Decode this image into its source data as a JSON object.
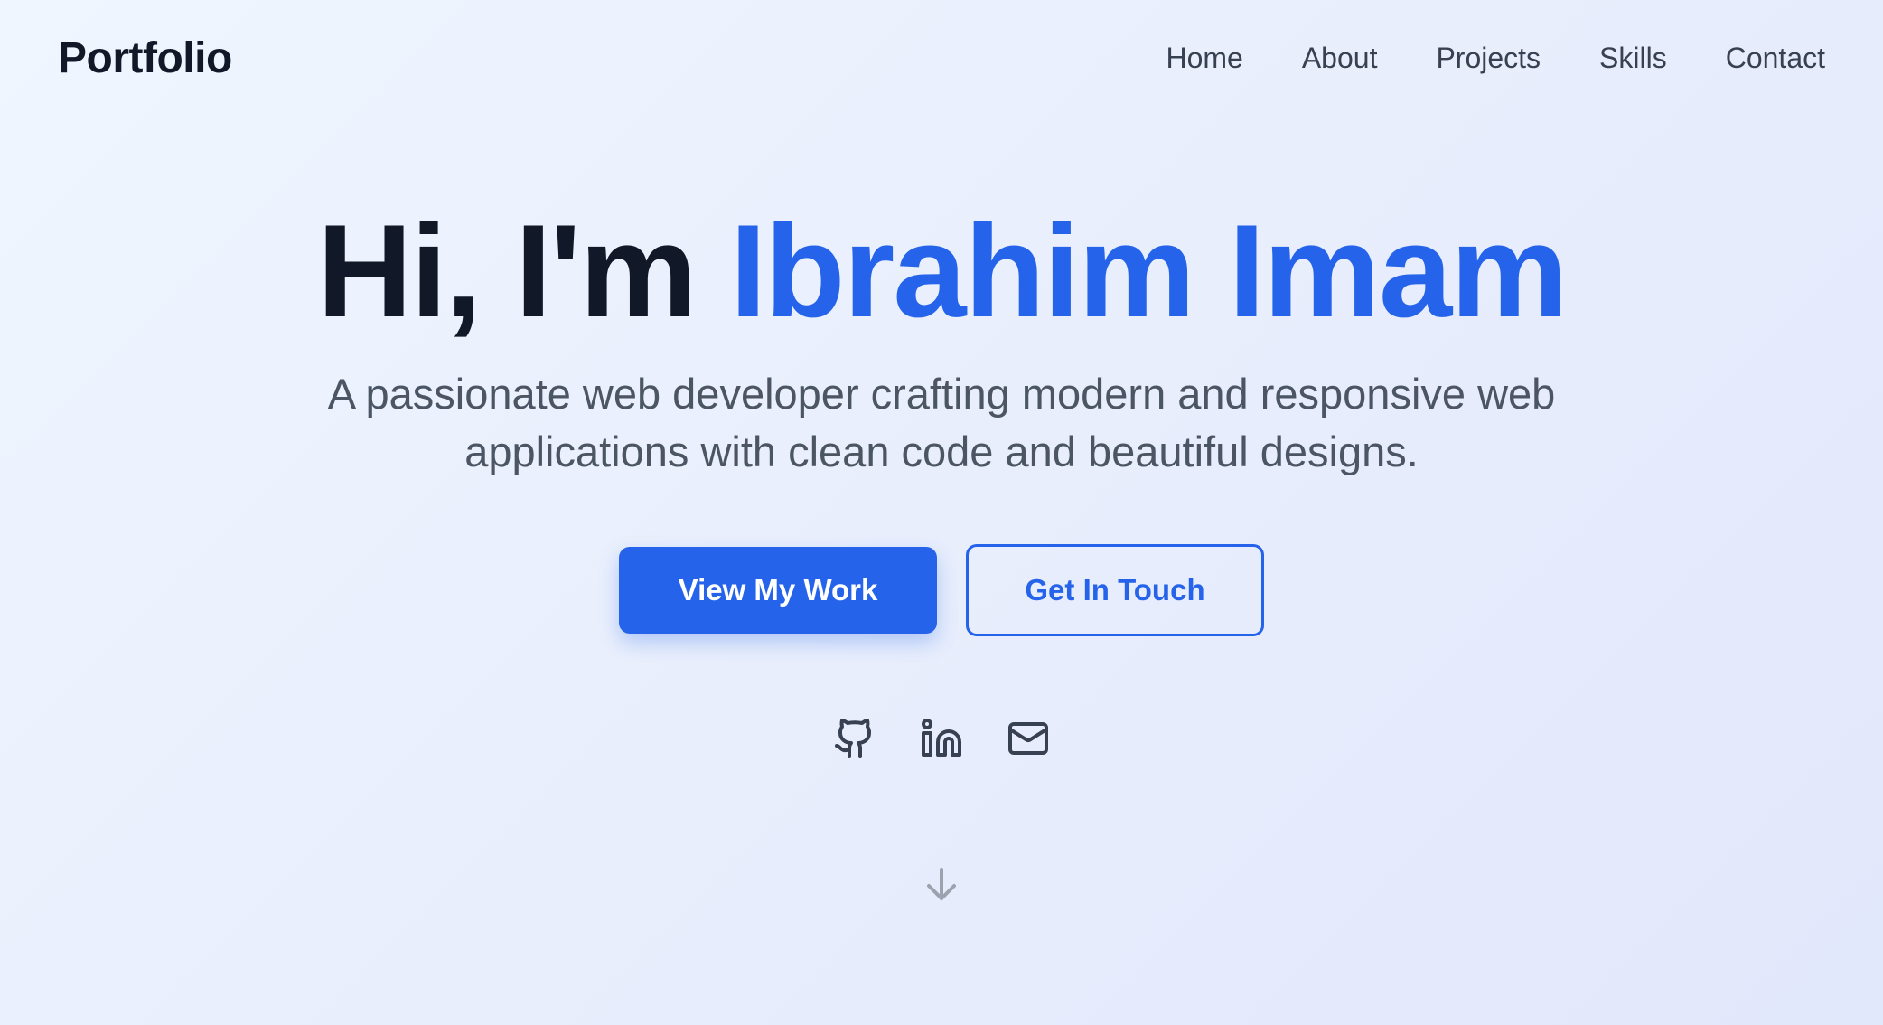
{
  "navbar": {
    "brand": "Portfolio",
    "links": [
      "Home",
      "About",
      "Projects",
      "Skills",
      "Contact"
    ]
  },
  "hero": {
    "greeting": "Hi, I'm",
    "name": "Ibrahim Imam",
    "subtitle": "A passionate web developer crafting modern and responsive web applications with clean code and beautiful designs.",
    "primary_button": "View My Work",
    "secondary_button": "Get In Touch"
  },
  "socials": {
    "icons": [
      "github-icon",
      "linkedin-icon",
      "mail-icon"
    ]
  },
  "scroll_hint": {
    "icon": "arrow-down-icon"
  },
  "colors": {
    "accent": "#2563eb",
    "heading": "#111827",
    "body_text": "#4b5563",
    "icon": "#374151",
    "muted_icon": "#9ca3af"
  }
}
